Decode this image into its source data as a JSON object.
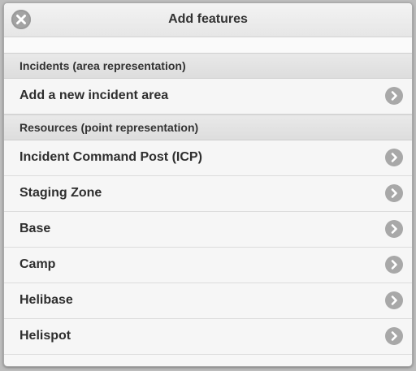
{
  "dialog": {
    "title": "Add features",
    "close_icon": "close-icon"
  },
  "sections": [
    {
      "header": "Incidents (area representation)",
      "items": [
        {
          "label": "Add a new incident area",
          "icon": "chevron-right-icon"
        }
      ]
    },
    {
      "header": "Resources (point representation)",
      "items": [
        {
          "label": "Incident Command Post (ICP)",
          "icon": "chevron-right-icon"
        },
        {
          "label": "Staging Zone",
          "icon": "chevron-right-icon"
        },
        {
          "label": "Base",
          "icon": "chevron-right-icon"
        },
        {
          "label": "Camp",
          "icon": "chevron-right-icon"
        },
        {
          "label": "Helibase",
          "icon": "chevron-right-icon"
        },
        {
          "label": "Helispot",
          "icon": "chevron-right-icon"
        }
      ]
    }
  ],
  "colors": {
    "header_bg": "#ececec",
    "divider_bg": "#e3e3e3",
    "item_bg": "#f6f6f6",
    "icon_bg": "#a8a8a8",
    "text": "#333333"
  }
}
